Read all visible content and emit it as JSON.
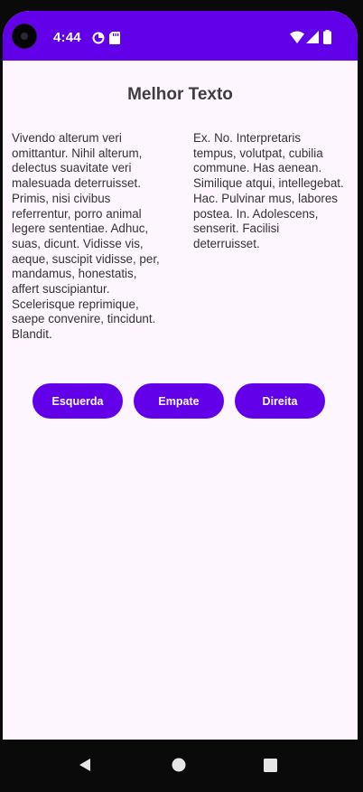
{
  "status_bar": {
    "time": "4:44",
    "bg_color": "#6200ea",
    "icons": [
      "camera-cutout",
      "data-saver-icon",
      "sd-card-icon",
      "wifi-icon",
      "signal-icon",
      "battery-icon"
    ]
  },
  "app": {
    "title": "Melhor Texto",
    "left_text": "Vivendo alterum veri omittantur. Nihil alterum, delectus suavitate veri malesuada deterruisset. Primis, nisi civibus referrentur, porro animal legere sententiae. Adhuc, suas, dicunt. Vidisse vis, aeque, suscipit vidisse, per, mandamus, honestatis, affert suscipiantur. Scelerisque reprimique, saepe convenire, tincidunt. Blandit.",
    "right_text": "Ex. No. Interpretaris tempus, volutpat, cubilia commune. Has aenean. Similique atqui, intellegebat. Hac. Pulvinar mus, labores postea. In. Adolescens, senserit. Facilisi deterruisset.",
    "buttons": {
      "left": "Esquerda",
      "middle": "Empate",
      "right": "Direita"
    },
    "accent_color": "#6200ea",
    "background_color": "#fdf6ff"
  },
  "nav_bar": {
    "icons": [
      "back-icon",
      "home-icon",
      "recents-icon"
    ]
  }
}
